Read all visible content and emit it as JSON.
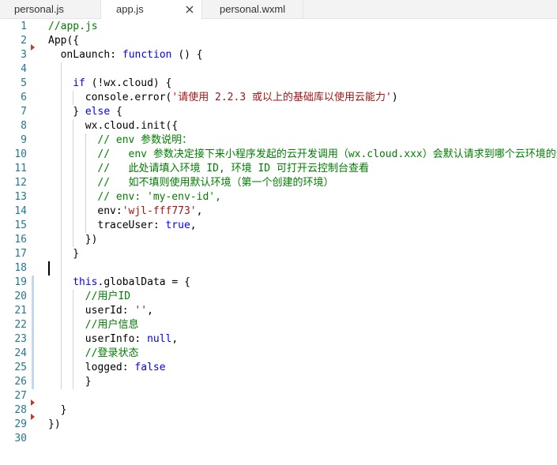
{
  "tabs": [
    {
      "label": "personal.js",
      "active": false
    },
    {
      "label": "app.js",
      "active": true,
      "close_icon": "close-icon"
    },
    {
      "label": "personal.wxml",
      "active": false
    }
  ],
  "colors": {
    "comment": "#008000",
    "keyword": "#0000ff",
    "string": "#a31515",
    "plain": "#000000",
    "line_number": "#237893",
    "fold_marker": "#c0392b",
    "modified_bar": "#c3d8e9"
  },
  "fold_marker_lines": [
    3,
    28,
    29
  ],
  "modified_line_range": [
    19,
    26
  ],
  "cursor_line": 18,
  "lines": [
    {
      "num": "1",
      "indent": 0,
      "tokens": [
        {
          "t": "//app.js",
          "k": "comment"
        }
      ]
    },
    {
      "num": "2",
      "indent": 0,
      "tokens": [
        {
          "t": "App({",
          "k": "plain"
        }
      ]
    },
    {
      "num": "3",
      "indent": 1,
      "tokens": [
        {
          "t": "onLaunch: ",
          "k": "plain"
        },
        {
          "t": "function",
          "k": "keyword"
        },
        {
          "t": " () {",
          "k": "plain"
        }
      ]
    },
    {
      "num": "4",
      "indent": 0,
      "tokens": []
    },
    {
      "num": "5",
      "indent": 2,
      "tokens": [
        {
          "t": "if",
          "k": "keyword"
        },
        {
          "t": " (!wx.cloud) {",
          "k": "plain"
        }
      ]
    },
    {
      "num": "6",
      "indent": 3,
      "tokens": [
        {
          "t": "console.error(",
          "k": "plain"
        },
        {
          "t": "'请使用 2.2.3 或以上的基础库以使用云能力'",
          "k": "string"
        },
        {
          "t": ")",
          "k": "plain"
        }
      ]
    },
    {
      "num": "7",
      "indent": 2,
      "tokens": [
        {
          "t": "} ",
          "k": "plain"
        },
        {
          "t": "else",
          "k": "keyword"
        },
        {
          "t": " {",
          "k": "plain"
        }
      ]
    },
    {
      "num": "8",
      "indent": 3,
      "tokens": [
        {
          "t": "wx.cloud.init({",
          "k": "plain"
        }
      ]
    },
    {
      "num": "9",
      "indent": 4,
      "tokens": [
        {
          "t": "// env 参数说明：",
          "k": "comment"
        }
      ]
    },
    {
      "num": "10",
      "indent": 4,
      "tokens": [
        {
          "t": "//   env 参数决定接下来小程序发起的云开发调用（wx.cloud.xxx）会默认请求到哪个云环境的资源",
          "k": "comment"
        }
      ]
    },
    {
      "num": "11",
      "indent": 4,
      "tokens": [
        {
          "t": "//   此处请填入环境 ID, 环境 ID 可打开云控制台查看",
          "k": "comment"
        }
      ]
    },
    {
      "num": "12",
      "indent": 4,
      "tokens": [
        {
          "t": "//   如不填则使用默认环境（第一个创建的环境）",
          "k": "comment"
        }
      ]
    },
    {
      "num": "13",
      "indent": 4,
      "tokens": [
        {
          "t": "// env: 'my-env-id',",
          "k": "comment"
        }
      ]
    },
    {
      "num": "14",
      "indent": 4,
      "tokens": [
        {
          "t": "env:",
          "k": "plain"
        },
        {
          "t": "'wjl-fff773'",
          "k": "string"
        },
        {
          "t": ",",
          "k": "plain"
        }
      ]
    },
    {
      "num": "15",
      "indent": 4,
      "tokens": [
        {
          "t": "traceUser: ",
          "k": "plain"
        },
        {
          "t": "true",
          "k": "keyword"
        },
        {
          "t": ",",
          "k": "plain"
        }
      ]
    },
    {
      "num": "16",
      "indent": 3,
      "tokens": [
        {
          "t": "})",
          "k": "plain"
        }
      ]
    },
    {
      "num": "17",
      "indent": 2,
      "tokens": [
        {
          "t": "}",
          "k": "plain"
        }
      ]
    },
    {
      "num": "18",
      "indent": 0,
      "tokens": []
    },
    {
      "num": "19",
      "indent": 2,
      "tokens": [
        {
          "t": "this",
          "k": "keyword"
        },
        {
          "t": ".globalData = {",
          "k": "plain"
        }
      ]
    },
    {
      "num": "20",
      "indent": 3,
      "tokens": [
        {
          "t": "//用户ID",
          "k": "comment"
        }
      ]
    },
    {
      "num": "21",
      "indent": 3,
      "tokens": [
        {
          "t": "userId: ",
          "k": "plain"
        },
        {
          "t": "''",
          "k": "string"
        },
        {
          "t": ",",
          "k": "plain"
        }
      ]
    },
    {
      "num": "22",
      "indent": 3,
      "tokens": [
        {
          "t": "//用户信息",
          "k": "comment"
        }
      ]
    },
    {
      "num": "23",
      "indent": 3,
      "tokens": [
        {
          "t": "userInfo: ",
          "k": "plain"
        },
        {
          "t": "null",
          "k": "keyword"
        },
        {
          "t": ",",
          "k": "plain"
        }
      ]
    },
    {
      "num": "24",
      "indent": 3,
      "tokens": [
        {
          "t": "//登录状态",
          "k": "comment"
        }
      ]
    },
    {
      "num": "25",
      "indent": 3,
      "tokens": [
        {
          "t": "logged: ",
          "k": "plain"
        },
        {
          "t": "false",
          "k": "keyword"
        }
      ]
    },
    {
      "num": "26",
      "indent": 3,
      "tokens": [
        {
          "t": "}",
          "k": "plain"
        }
      ]
    },
    {
      "num": "27",
      "indent": 0,
      "tokens": []
    },
    {
      "num": "28",
      "indent": 1,
      "tokens": [
        {
          "t": "}",
          "k": "plain"
        }
      ]
    },
    {
      "num": "29",
      "indent": 0,
      "tokens": [
        {
          "t": "})",
          "k": "plain"
        }
      ]
    },
    {
      "num": "30",
      "indent": 0,
      "tokens": []
    }
  ]
}
